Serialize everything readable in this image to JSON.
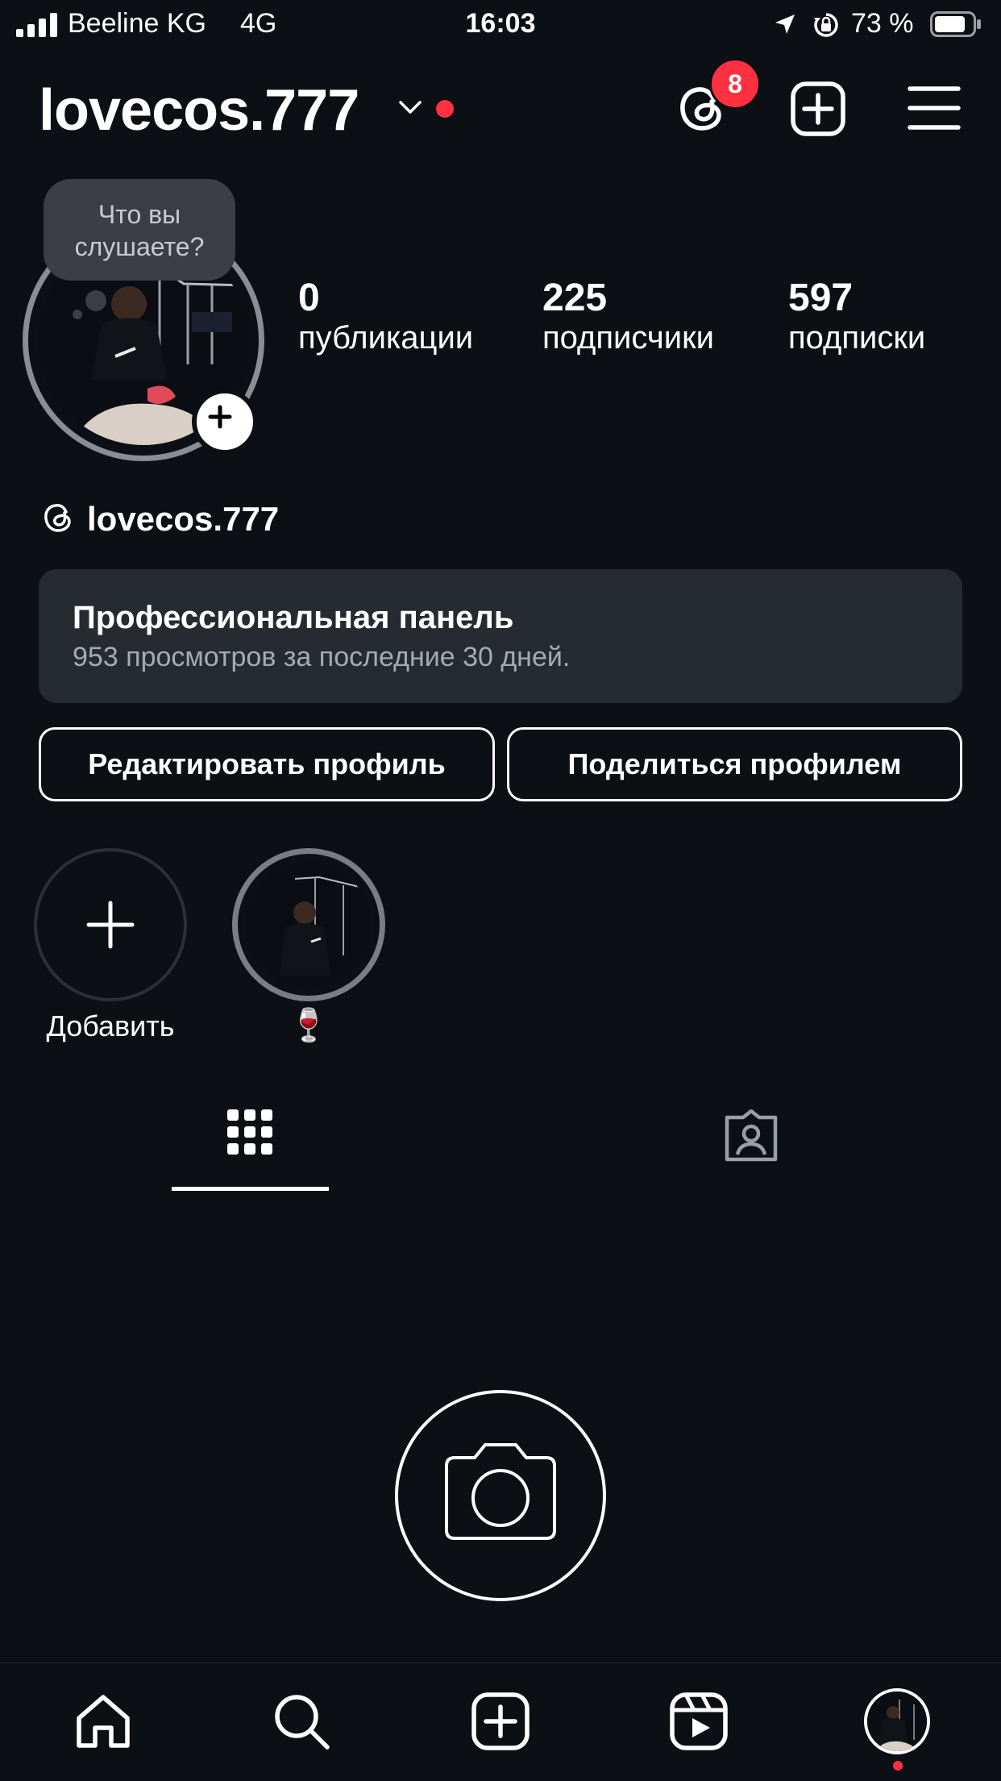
{
  "status_bar": {
    "carrier": "Beeline KG",
    "network": "4G",
    "time": "16:03",
    "battery_percent": "73 %"
  },
  "header": {
    "username": "lovecos.777",
    "threads_badge_count": "8",
    "accent_color": "#ff3040"
  },
  "note": {
    "text_line1": "Что вы",
    "text_line2": "слушаете?"
  },
  "stats": [
    {
      "value": "0",
      "label": "публикации"
    },
    {
      "value": "225",
      "label": "подписчики"
    },
    {
      "value": "597",
      "label": "подписки"
    }
  ],
  "threads_link": {
    "username": "lovecos.777"
  },
  "pro_panel": {
    "title": "Профессиональная панель",
    "subtitle": "953 просмотров за последние 30 дней."
  },
  "buttons": {
    "edit_profile": "Редактировать профиль",
    "share_profile": "Поделиться профилем"
  },
  "highlights": {
    "add_label": "Добавить",
    "items": [
      {
        "label": "🍷"
      }
    ]
  },
  "tabs": [
    {
      "icon": "grid-icon",
      "active": true
    },
    {
      "icon": "tagged-icon",
      "active": false
    }
  ],
  "bottom_nav": [
    {
      "icon": "home-icon"
    },
    {
      "icon": "search-icon"
    },
    {
      "icon": "create-icon"
    },
    {
      "icon": "reels-icon"
    },
    {
      "icon": "profile-avatar"
    }
  ]
}
